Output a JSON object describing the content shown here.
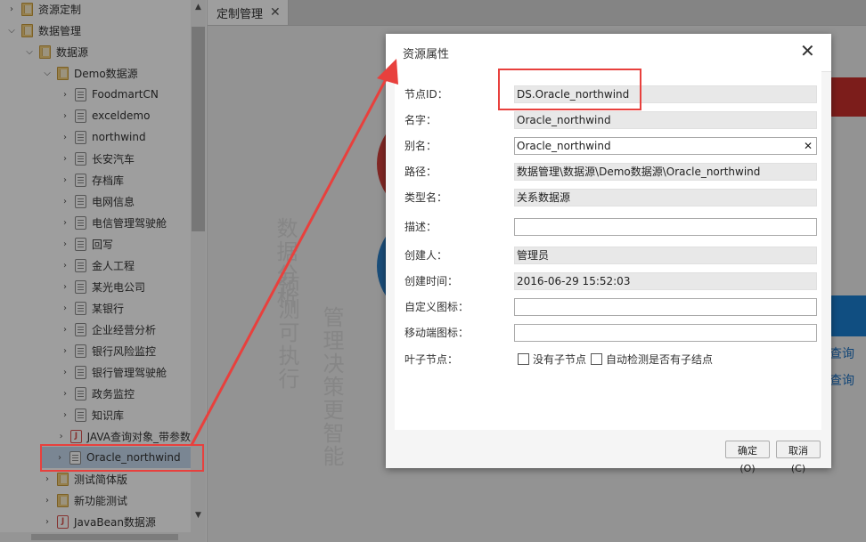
{
  "tree": {
    "items": [
      {
        "label": "资源定制",
        "indent": 0,
        "icon": "folder-icon",
        "expanded": false
      },
      {
        "label": "数据管理",
        "indent": 0,
        "icon": "folder-icon",
        "expanded": true
      },
      {
        "label": "数据源",
        "indent": 1,
        "icon": "folder-icon",
        "expanded": true
      },
      {
        "label": "Demo数据源",
        "indent": 2,
        "icon": "folder-icon",
        "expanded": true
      },
      {
        "label": "FoodmartCN",
        "indent": 3,
        "icon": "datasource-icon",
        "expanded": false
      },
      {
        "label": "exceldemo",
        "indent": 3,
        "icon": "datasource-icon",
        "expanded": false
      },
      {
        "label": "northwind",
        "indent": 3,
        "icon": "datasource-icon",
        "expanded": false
      },
      {
        "label": "长安汽车",
        "indent": 3,
        "icon": "datasource-icon",
        "expanded": false
      },
      {
        "label": "存档库",
        "indent": 3,
        "icon": "datasource-icon",
        "expanded": false
      },
      {
        "label": "电网信息",
        "indent": 3,
        "icon": "datasource-icon",
        "expanded": false
      },
      {
        "label": "电信管理驾驶舱",
        "indent": 3,
        "icon": "datasource-icon",
        "expanded": false
      },
      {
        "label": "回写",
        "indent": 3,
        "icon": "datasource-icon",
        "expanded": false
      },
      {
        "label": "金人工程",
        "indent": 3,
        "icon": "datasource-icon",
        "expanded": false
      },
      {
        "label": "某光电公司",
        "indent": 3,
        "icon": "datasource-icon",
        "expanded": false
      },
      {
        "label": "某银行",
        "indent": 3,
        "icon": "datasource-icon",
        "expanded": false
      },
      {
        "label": "企业经营分析",
        "indent": 3,
        "icon": "datasource-icon",
        "expanded": false
      },
      {
        "label": "银行风险监控",
        "indent": 3,
        "icon": "datasource-icon",
        "expanded": false
      },
      {
        "label": "银行管理驾驶舱",
        "indent": 3,
        "icon": "datasource-icon",
        "expanded": false
      },
      {
        "label": "政务监控",
        "indent": 3,
        "icon": "datasource-icon",
        "expanded": false
      },
      {
        "label": "知识库",
        "indent": 3,
        "icon": "datasource-icon",
        "expanded": false
      },
      {
        "label": "JAVA查询对象_带参数",
        "indent": 3,
        "icon": "java-icon",
        "expanded": false
      },
      {
        "label": "Oracle_northwind",
        "indent": 3,
        "icon": "datasource-icon",
        "expanded": false,
        "selected": true
      },
      {
        "label": "测试简体版",
        "indent": 2,
        "icon": "folder-icon",
        "expanded": false
      },
      {
        "label": "新功能测试",
        "indent": 2,
        "icon": "folder-icon",
        "expanded": false
      },
      {
        "label": "JavaBean数据源",
        "indent": 2,
        "icon": "java-icon",
        "expanded": false
      }
    ]
  },
  "tab": {
    "label": "定制管理",
    "close": "✕"
  },
  "background": {
    "link1": "查询",
    "link2": "查询",
    "vtext": [
      "数据分析",
      "预测可执行",
      "管理决策更智能"
    ]
  },
  "dialog": {
    "title": "资源属性",
    "close": "✕",
    "fields": [
      {
        "label": "节点ID：",
        "value": "DS.Oracle_northwind",
        "readonly": true
      },
      {
        "label": "名字：",
        "value": "Oracle_northwind",
        "readonly": true
      },
      {
        "label": "别名：",
        "value": "Oracle_northwind",
        "readonly": false,
        "clear": "✕"
      },
      {
        "label": "路径：",
        "value": "数据管理\\数据源\\Demo数据源\\Oracle_northwind",
        "readonly": true
      },
      {
        "label": "类型名：",
        "value": "关系数据源",
        "readonly": true
      },
      {
        "label": "描述：",
        "value": "",
        "readonly": false
      },
      {
        "label": "创建人：",
        "value": "管理员",
        "readonly": true
      },
      {
        "label": "创建时间：",
        "value": "2016-06-29 15:52:03",
        "readonly": true
      },
      {
        "label": "自定义图标：",
        "value": "",
        "readonly": false
      },
      {
        "label": "移动端图标：",
        "value": "",
        "readonly": false
      }
    ],
    "leaf": {
      "label": "叶子节点：",
      "opt1": "没有子节点",
      "opt2": "自动检测是否有子结点"
    },
    "ok_label": "确定(O)",
    "cancel_label": "取消(C)"
  },
  "colors": {
    "annotation": "#e8403d",
    "selection": "#c6d9ee"
  }
}
